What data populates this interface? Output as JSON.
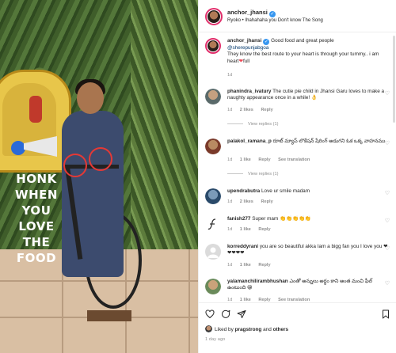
{
  "photo": {
    "overlay_text": [
      "HONK",
      "WHEN",
      "YOU",
      "LOVE",
      "THE",
      "FOOD"
    ]
  },
  "post": {
    "author": "anchor_jhansi",
    "audio": "Ryoko • Ihahahaha you Don't know The Song"
  },
  "caption": {
    "user": "anchor_jhansi",
    "text": "Good food and great people",
    "mention": "@sherepunjabgoa",
    "text2": "They know the best route to your heart is through your tummy.. i am heart",
    "heart": "❤",
    "text3": "full",
    "time": "1d"
  },
  "comments": [
    {
      "user": "phanindra_ivatury",
      "text": "The cutie pie child in Jhansi Garu loves to make a naughty appearance once in a while! 👌",
      "time": "1d",
      "likes": "2 likes",
      "reply": "Reply",
      "view_replies": "View replies (1)"
    },
    {
      "user": "palakol_ramana_p",
      "text": "రూట్ మ్యాప్ లొకేషన్ షేరింగ్ అడుగని ఓక ఒక్క వాహనము",
      "time": "1d",
      "likes": "1 like",
      "reply": "Reply",
      "translation": "See translation",
      "view_replies": "View replies (1)"
    },
    {
      "user": "upendrabutra",
      "text": "Love ur smile madam",
      "time": "1d",
      "likes": "2 likes",
      "reply": "Reply"
    },
    {
      "user": "fanish277",
      "text": "Super mam 👏👏👏👏👏",
      "time": "1d",
      "likes": "1 like",
      "reply": "Reply"
    },
    {
      "user": "korreddyrani",
      "text": "you are so beautiful akka Iam a bigg fan you I love you ❤❤❤❤❤",
      "time": "1d",
      "likes": "1 like",
      "reply": "Reply"
    },
    {
      "user": "yalamanchilirambhushan",
      "text": "ఎంతో అన్నులు అర్థం కాని అంత మంచి ఫీల్ ఉంటుంది 😀",
      "time": "1d",
      "likes": "1 like",
      "reply": "Reply",
      "translation": "See translation"
    }
  ],
  "footer": {
    "liked_by_prefix": "Liked by",
    "liked_by_user": "pragstrong",
    "liked_by_and": "and",
    "liked_by_others": "others",
    "ago": "1 day ago"
  },
  "icons": {
    "like": "heart-outline-icon",
    "comment": "comment-bubble-icon",
    "share": "paper-plane-icon",
    "save": "bookmark-icon",
    "verified": "verified-badge-icon",
    "comment_like": "small-heart-icon"
  },
  "colors": {
    "accent_link": "#00376b",
    "verified": "#3897f0",
    "heart": "#ed4956",
    "muted": "#8e8e8e",
    "story_ring": "#e1306c"
  }
}
